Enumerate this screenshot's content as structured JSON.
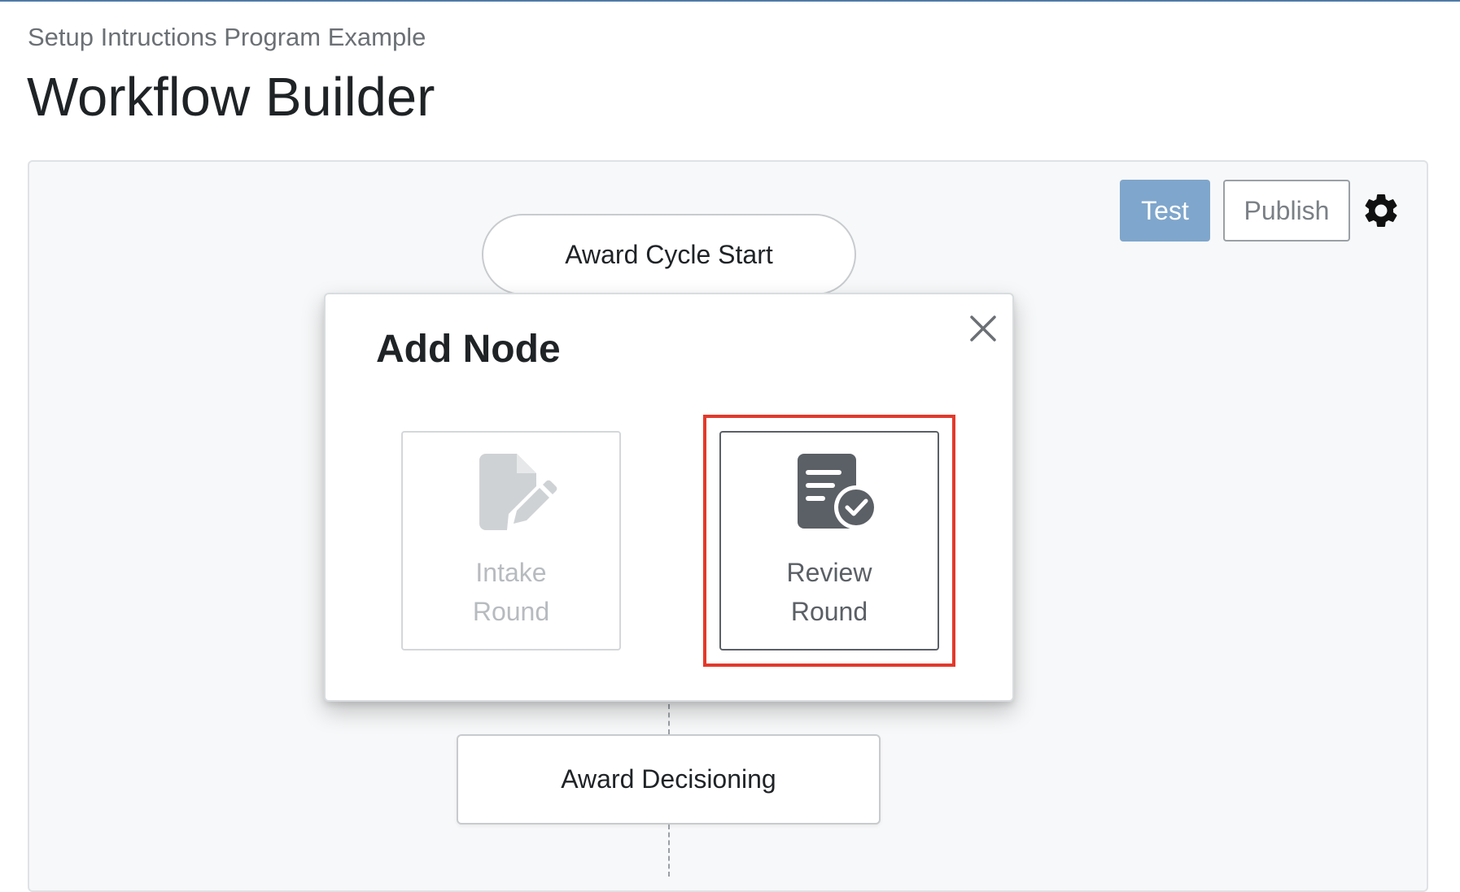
{
  "header": {
    "subtitle": "Setup Intructions Program Example",
    "title": "Workflow Builder"
  },
  "toolbar": {
    "test_label": "Test",
    "publish_label": "Publish",
    "settings_icon": "gear-icon"
  },
  "workflow": {
    "start_node_label": "Award Cycle Start",
    "decision_node_label": "Award Decisioning"
  },
  "add_node_modal": {
    "title": "Add Node",
    "close_icon": "close-icon",
    "options": [
      {
        "line1": "Intake",
        "line2": "Round",
        "icon": "document-edit-icon",
        "state": "disabled"
      },
      {
        "line1": "Review",
        "line2": "Round",
        "icon": "document-check-icon",
        "state": "highlighted"
      }
    ]
  },
  "colors": {
    "top_rule": "#4f7aa6",
    "test_button": "#7fa6cc",
    "highlight": "#e2392b",
    "icon_active": "#5b6066",
    "icon_disabled": "#cfd2d5"
  }
}
